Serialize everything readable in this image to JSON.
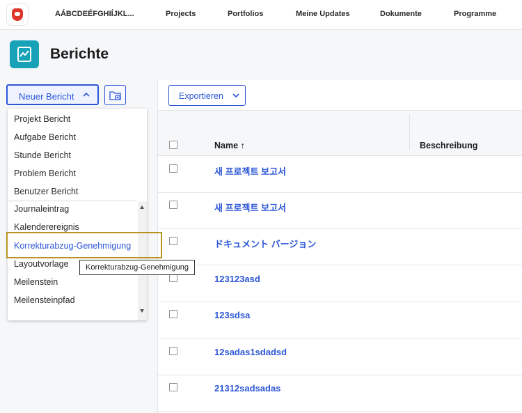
{
  "nav": {
    "brand": "AÁBCDEÉFGHIÍJKL...",
    "items": [
      "Projects",
      "Portfolios",
      "Meine Updates",
      "Dokumente",
      "Programme"
    ]
  },
  "page": {
    "title": "Berichte"
  },
  "new_report": {
    "label": "Neuer Bericht",
    "menu": [
      "Projekt Bericht",
      "Aufgabe Bericht",
      "Stunde Bericht",
      "Problem Bericht",
      "Benutzer Bericht",
      "Journaleintrag",
      "Kalenderereignis",
      "Korrekturabzug-Genehmigung",
      "Layoutvorlage",
      "Meilenstein",
      "Meilensteinpfad"
    ],
    "tooltip": "Korrekturabzug-Genehmigung"
  },
  "toolbar": {
    "export_label": "Exportieren"
  },
  "table": {
    "col_name": "Name",
    "sort_arrow": "↑",
    "col_description": "Beschreibung",
    "rows": [
      "새 프로젝트 보고서",
      "새 프로젝트 보고서",
      "ドキュメント バージョン",
      "123123asd",
      "123sdsa",
      "12sadas1sdadsd",
      "21312sadsadas"
    ]
  },
  "colors": {
    "accent": "#2c56d6",
    "highlight": "#b8941e",
    "page_icon": "#17a2b8"
  }
}
